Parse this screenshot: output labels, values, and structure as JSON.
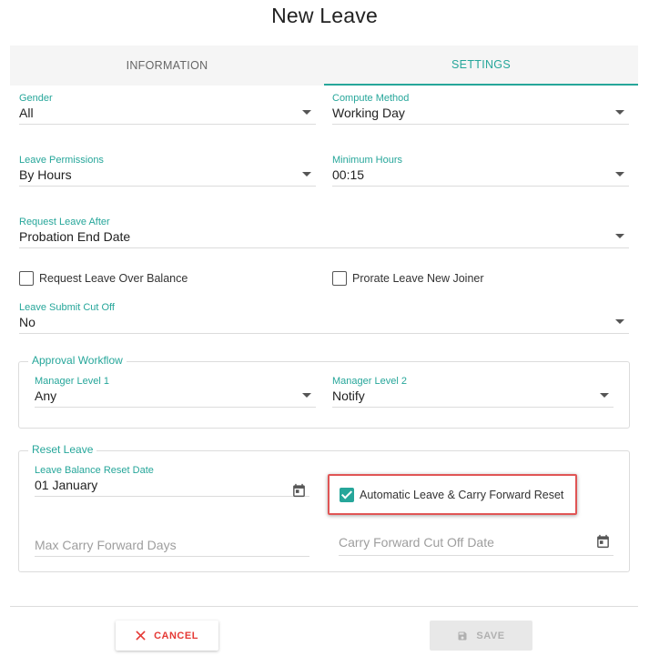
{
  "dialog": {
    "title": "New Leave"
  },
  "tabs": [
    {
      "label": "INFORMATION",
      "active": false
    },
    {
      "label": "SETTINGS",
      "active": true
    }
  ],
  "fields": {
    "gender": {
      "label": "Gender",
      "value": "All"
    },
    "compute_method": {
      "label": "Compute Method",
      "value": "Working Day"
    },
    "leave_permissions": {
      "label": "Leave Permissions",
      "value": "By Hours"
    },
    "minimum_hours": {
      "label": "Minimum Hours",
      "value": "00:15"
    },
    "request_leave_after": {
      "label": "Request Leave After",
      "value": "Probation End Date"
    },
    "leave_submit_cut_off": {
      "label": "Leave Submit Cut Off",
      "value": "No"
    }
  },
  "checkboxes": {
    "request_over_balance": {
      "label": "Request Leave Over Balance",
      "checked": false
    },
    "prorate_new_joiner": {
      "label": "Prorate Leave New Joiner",
      "checked": false
    },
    "auto_carry_forward_reset": {
      "label": "Automatic Leave & Carry Forward Reset",
      "checked": true
    }
  },
  "approval": {
    "legend": "Approval Workflow",
    "manager_level_1": {
      "label": "Manager Level 1",
      "value": "Any"
    },
    "manager_level_2": {
      "label": "Manager Level 2",
      "value": "Notify"
    }
  },
  "reset": {
    "legend": "Reset Leave",
    "balance_reset_date": {
      "label": "Leave Balance Reset Date",
      "value": "01 January"
    },
    "max_carry_forward_days": {
      "placeholder": "Max Carry Forward Days"
    },
    "carry_forward_cut_off_date": {
      "placeholder": "Carry Forward Cut Off Date"
    }
  },
  "buttons": {
    "cancel": "CANCEL",
    "save": "SAVE"
  },
  "icons": {
    "calendar": "calendar-icon",
    "cancel": "close-icon",
    "save": "floppy-disk-icon",
    "dropdown": "caret-down-icon"
  },
  "colors": {
    "accent": "#26a69a",
    "cancel": "#e53935",
    "highlight": "#e05555"
  }
}
